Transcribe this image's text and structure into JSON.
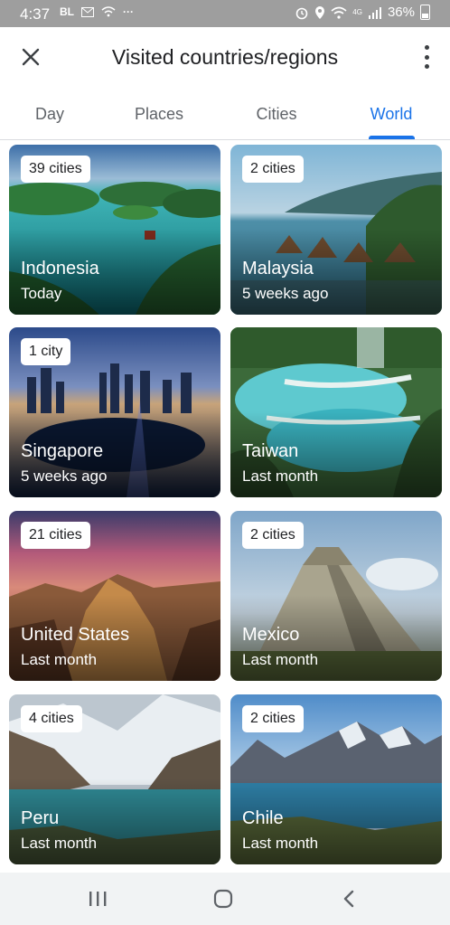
{
  "status_bar": {
    "time": "4:37",
    "left_text": "BL",
    "battery": "36%",
    "signal_label": "4G"
  },
  "app_bar": {
    "title": "Visited countries/regions"
  },
  "tabs": [
    {
      "label": "Day"
    },
    {
      "label": "Places"
    },
    {
      "label": "Cities"
    },
    {
      "label": "World",
      "selected": true
    }
  ],
  "accent_color": "#1a73e8",
  "countries": [
    {
      "badge": "39 cities",
      "name": "Indonesia",
      "when": "Today"
    },
    {
      "badge": "2 cities",
      "name": "Malaysia",
      "when": "5 weeks ago"
    },
    {
      "badge": "1 city",
      "name": "Singapore",
      "when": "5 weeks ago"
    },
    {
      "badge": "",
      "name": "Taiwan",
      "when": "Last month"
    },
    {
      "badge": "21 cities",
      "name": "United States",
      "when": "Last month"
    },
    {
      "badge": "2 cities",
      "name": "Mexico",
      "when": "Last month"
    },
    {
      "badge": "4 cities",
      "name": "Peru",
      "when": "Last month"
    },
    {
      "badge": "2 cities",
      "name": "Chile",
      "when": "Last month"
    }
  ]
}
